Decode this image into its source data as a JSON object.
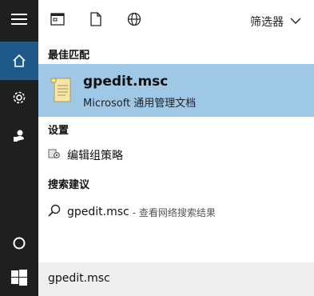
{
  "toolbar": {
    "icons": [
      "window-icon",
      "document-icon",
      "globe-icon"
    ],
    "filter_label": "筛选器"
  },
  "rail": {
    "items": [
      "menu-icon",
      "home-icon",
      "settings-icon",
      "user-icon",
      "cortana-circle-icon",
      "windows-start-icon"
    ]
  },
  "sections": {
    "best_match_title": "最佳匹配",
    "settings_title": "设置",
    "suggestions_title": "搜索建议"
  },
  "best_match": {
    "name": "gpedit.msc",
    "subtitle": "Microsoft 通用管理文档"
  },
  "settings_item": {
    "label": "编辑组策略"
  },
  "suggestion": {
    "query": "gpedit.msc",
    "suffix": "- 查看网络搜索结果"
  },
  "search": {
    "value": "gpedit.msc"
  },
  "colors": {
    "rail_bg": "#1f1f1f",
    "active_rail": "#1f5a8b",
    "highlight": "#9fc7e6",
    "search_bg": "#eeeeee"
  }
}
